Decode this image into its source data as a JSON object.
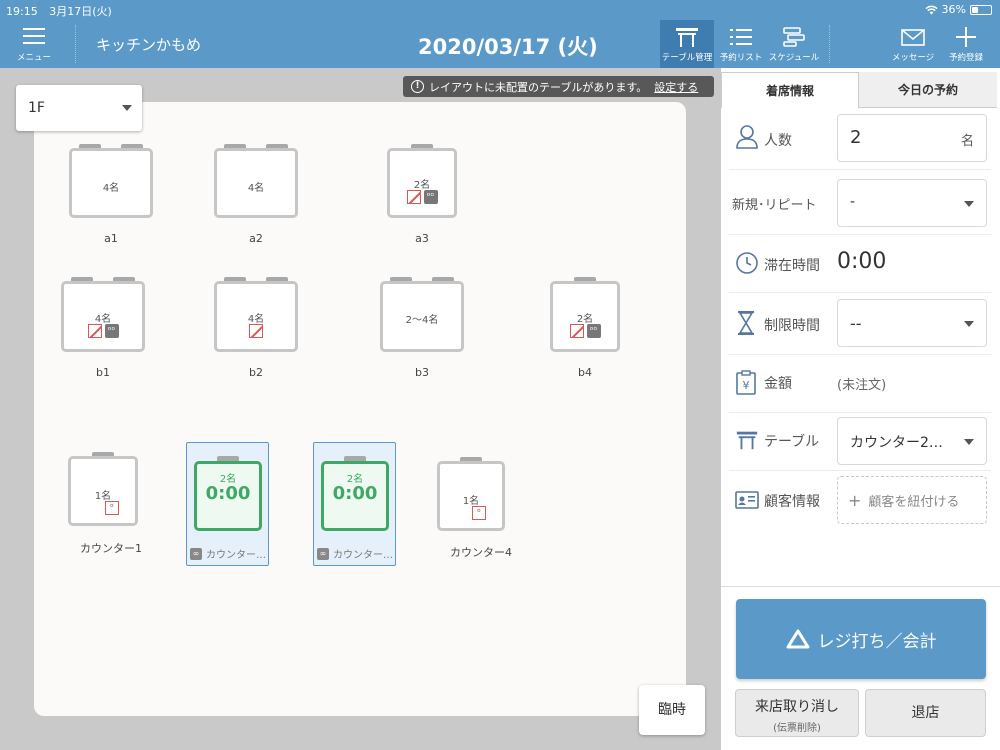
{
  "status_bar": {
    "time": "19:15",
    "date": "3月17日(火)",
    "battery": "36%",
    "battery_level": 0.36
  },
  "header": {
    "menu_label": "メニュー",
    "shop_name": "キッチンかもめ",
    "date_title": "2020/03/17 (火)",
    "tabs": [
      {
        "label": "テーブル管理",
        "icon": "table-icon",
        "active": true
      },
      {
        "label": "予約リスト",
        "icon": "list-icon",
        "active": false
      },
      {
        "label": "スケジュール",
        "icon": "schedule-icon",
        "active": false
      }
    ],
    "message_label": "メッセージ",
    "reserve_label": "予約登録"
  },
  "floor": {
    "selected": "1F",
    "notice": "レイアウトに未配置のテーブルがあります。",
    "notice_link": "設定する",
    "temporary_button": "臨時",
    "tables": [
      {
        "name": "a1",
        "capacity": "4名"
      },
      {
        "name": "a2",
        "capacity": "4名"
      },
      {
        "name": "a3",
        "capacity": "2名"
      },
      {
        "name": "b1",
        "capacity": "4名"
      },
      {
        "name": "b2",
        "capacity": "4名"
      },
      {
        "name": "b3",
        "capacity": "2〜4名"
      },
      {
        "name": "b4",
        "capacity": "2名"
      },
      {
        "name": "カウンター1",
        "capacity": "1名"
      },
      {
        "name": "カウンター…",
        "capacity": "2名",
        "elapsed": "0:00"
      },
      {
        "name": "カウンター…",
        "capacity": "2名",
        "elapsed": "0:00"
      },
      {
        "name": "カウンター4",
        "capacity": "1名"
      }
    ]
  },
  "panel": {
    "tabs": [
      "着席情報",
      "今日の予約"
    ],
    "guests_label": "人数",
    "guests_value": "2",
    "guests_unit": "名",
    "visit_type_label": "新規･リピート",
    "visit_type_value": "-",
    "stay_time_label": "滞在時間",
    "stay_time_value": "0:00",
    "limit_time_label": "制限時間",
    "limit_time_value": "--",
    "amount_label": "金額",
    "amount_value": "(未注文)",
    "table_label": "テーブル",
    "table_value": "カウンター2…",
    "customer_label": "顧客情報",
    "customer_value": "顧客を紐付ける",
    "register_button": "レジ打ち／会計",
    "cancel_visit_button": "来店取り消し",
    "cancel_visit_sub": "(伝票削除)",
    "leave_button": "退店"
  },
  "colors": {
    "accent": "#5b9ac8",
    "occupied": "#3fa864"
  }
}
